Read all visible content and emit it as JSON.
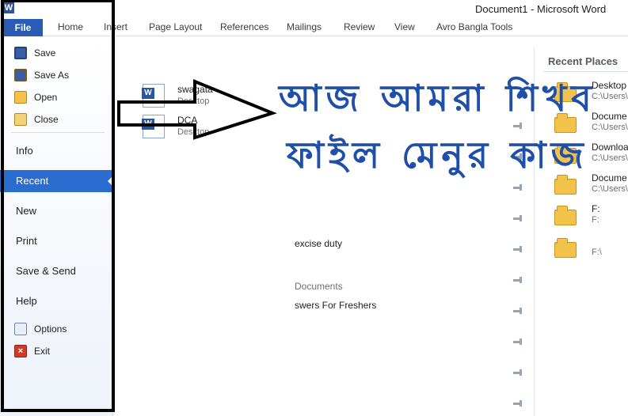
{
  "window": {
    "title": "Document1  -  Microsoft Word",
    "app_icon_letter": "W"
  },
  "ribbon": {
    "file_tab": "File",
    "tabs": [
      "Home",
      "Insert",
      "Page Layout",
      "References",
      "Mailings",
      "Review",
      "View",
      "Avro Bangla Tools"
    ]
  },
  "backstage": {
    "commands_top": [
      {
        "label": "Save",
        "icon": "save-icon"
      },
      {
        "label": "Save As",
        "icon": "save-as-icon"
      },
      {
        "label": "Open",
        "icon": "open-folder-icon"
      },
      {
        "label": "Close",
        "icon": "close-document-icon"
      }
    ],
    "sections": [
      "Info",
      "Recent",
      "New",
      "Print",
      "Save & Send",
      "Help"
    ],
    "selected_section": "Recent",
    "commands_bottom": [
      {
        "label": "Options",
        "icon": "options-icon"
      },
      {
        "label": "Exit",
        "icon": "exit-icon"
      }
    ]
  },
  "recent_documents": {
    "items": [
      {
        "name": "swagata",
        "location": "Desktop"
      },
      {
        "name": "DCA",
        "location": "Desktop"
      }
    ],
    "partial_texts": [
      "excise duty",
      "Documents",
      "swers For Freshers"
    ]
  },
  "recent_places": {
    "header": "Recent Places",
    "items": [
      {
        "name": "Desktop",
        "path": "C:\\Users\\"
      },
      {
        "name": "Docume",
        "path": "C:\\Users\\"
      },
      {
        "name": "Downloa",
        "path": "C:\\Users\\"
      },
      {
        "name": "Docume",
        "path": "C:\\Users\\"
      },
      {
        "name": "F:",
        "path": "F:"
      },
      {
        "name": "",
        "path": "F:\\"
      }
    ]
  },
  "annotation": {
    "line1": "আজ আমরা শিখব",
    "line2": "ফাইল মেনুর কাজ",
    "color": "#1f4fa8"
  }
}
